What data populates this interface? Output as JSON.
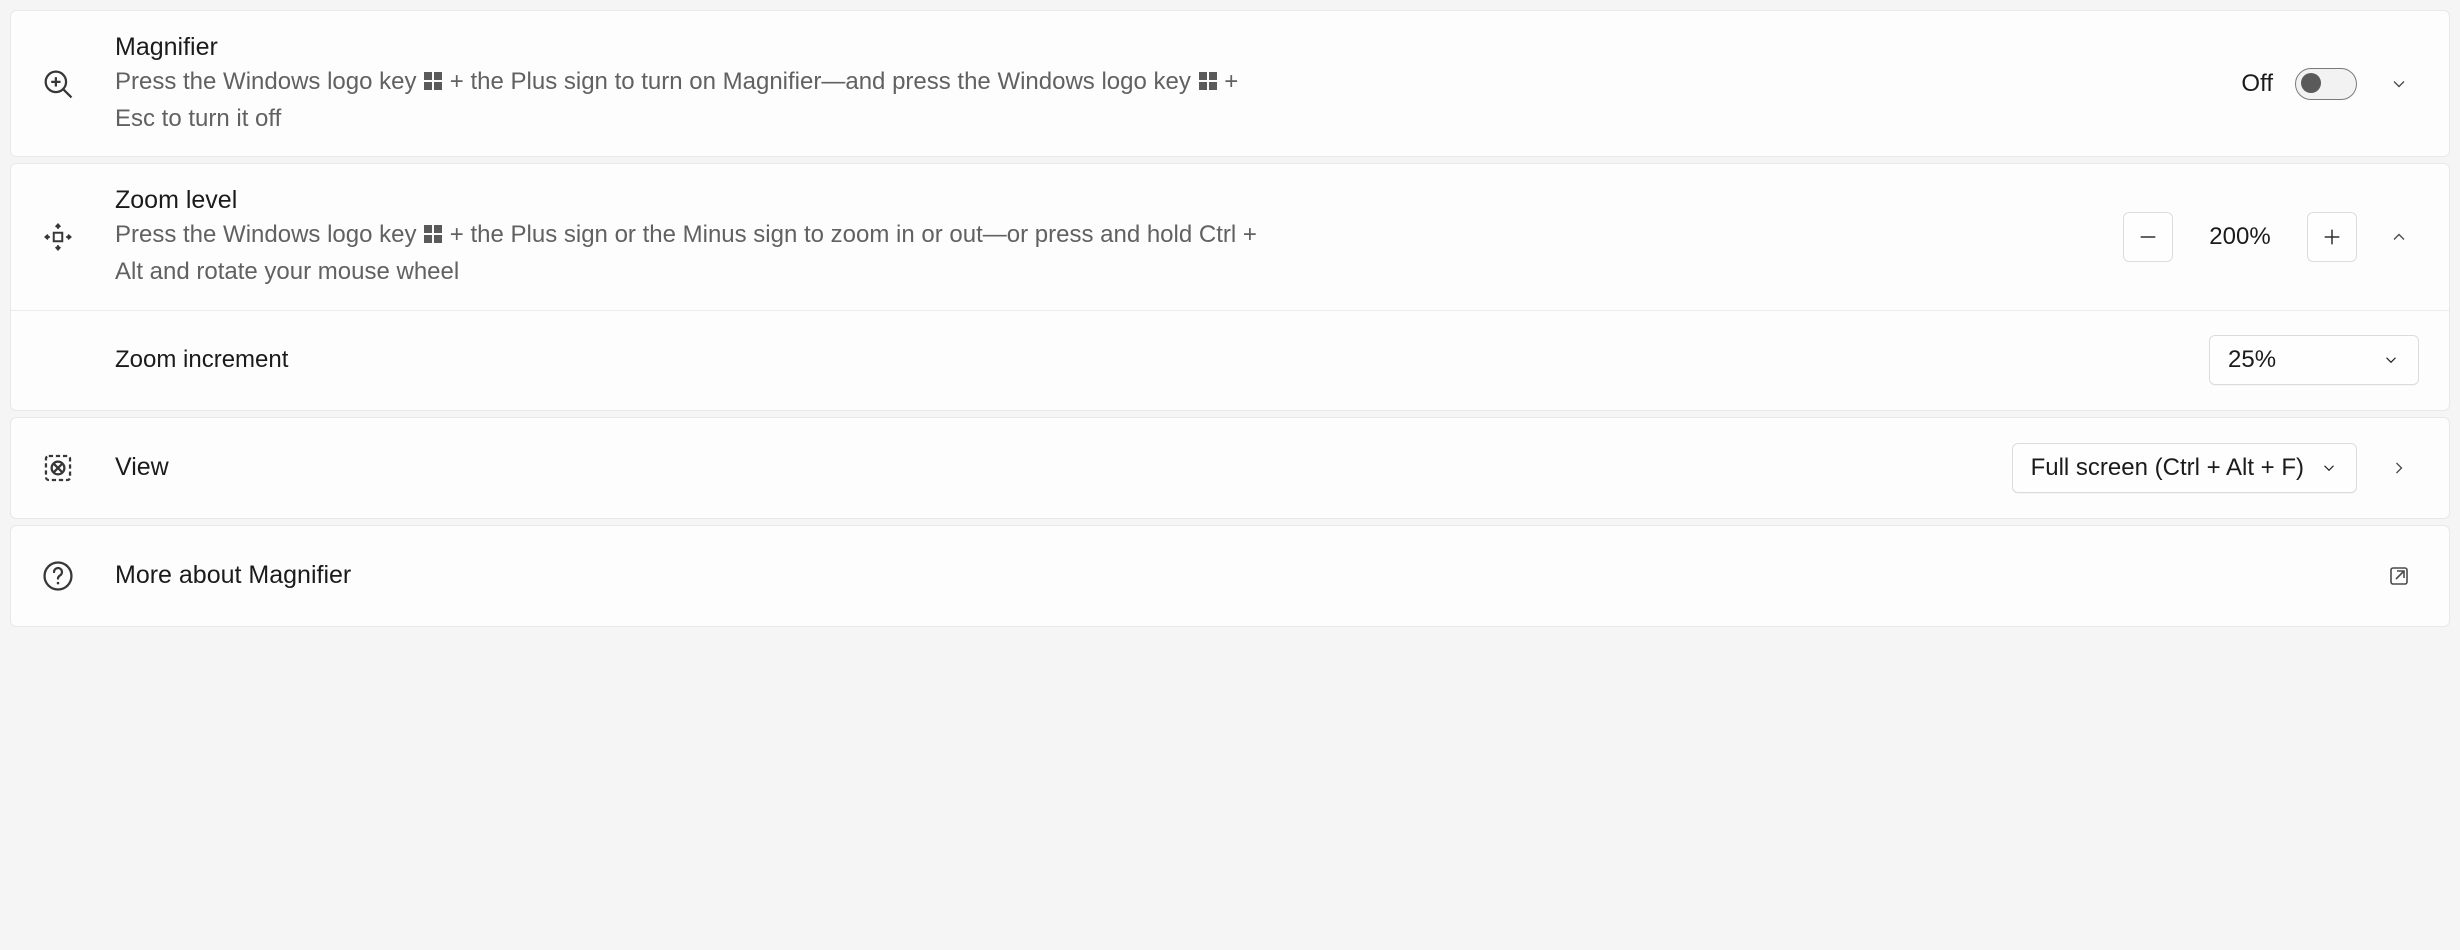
{
  "magnifier": {
    "title": "Magnifier",
    "desc_a": "Press the Windows logo key ",
    "desc_b": " + the Plus sign to turn on Magnifier—and press the Windows logo key ",
    "desc_c": " + Esc to turn it off",
    "toggle_label": "Off"
  },
  "zoom": {
    "title": "Zoom level",
    "desc_a": "Press the Windows logo key ",
    "desc_b": " + the Plus sign or the Minus sign to zoom in or out—or press and hold Ctrl + Alt and rotate your mouse wheel",
    "value": "200%",
    "increment_label": "Zoom increment",
    "increment_value": "25%"
  },
  "view": {
    "title": "View",
    "value": "Full screen (Ctrl + Alt + F)"
  },
  "more": {
    "title": "More about Magnifier"
  }
}
